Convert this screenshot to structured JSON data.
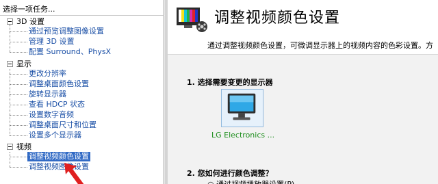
{
  "tasks_pane": {
    "title": "选择一项任务...",
    "groups": [
      {
        "label": "3D 设置",
        "items": [
          "通过预览调整图像设置",
          "管理 3D 设置",
          "配置 Surround、PhysX"
        ]
      },
      {
        "label": "显示",
        "items": [
          "更改分辨率",
          "调整桌面颜色设置",
          "旋转显示器",
          "查看 HDCP 状态",
          "设置数字音频",
          "调整桌面尺寸和位置",
          "设置多个显示器"
        ]
      },
      {
        "label": "视频",
        "items": [
          "调整视频颜色设置",
          "调整视频图像设置"
        ]
      }
    ],
    "selected_item": "调整视频颜色设置"
  },
  "content": {
    "title": "调整视频颜色设置",
    "description": "通过调整视频颜色设置，可微调显示器上的视频内容的色彩设置。方",
    "section1": "1. 选择需要变更的显示器",
    "monitor_name": "LG Electronics ...",
    "section2": "2. 您如何进行颜色调整？",
    "option1": "○ 通过视频播放器设置(P)"
  },
  "colors": {
    "link": "#1a4fa6",
    "selection": "#316ac5",
    "monitor_text": "#1e8e1e",
    "arrow": "#e02020"
  }
}
